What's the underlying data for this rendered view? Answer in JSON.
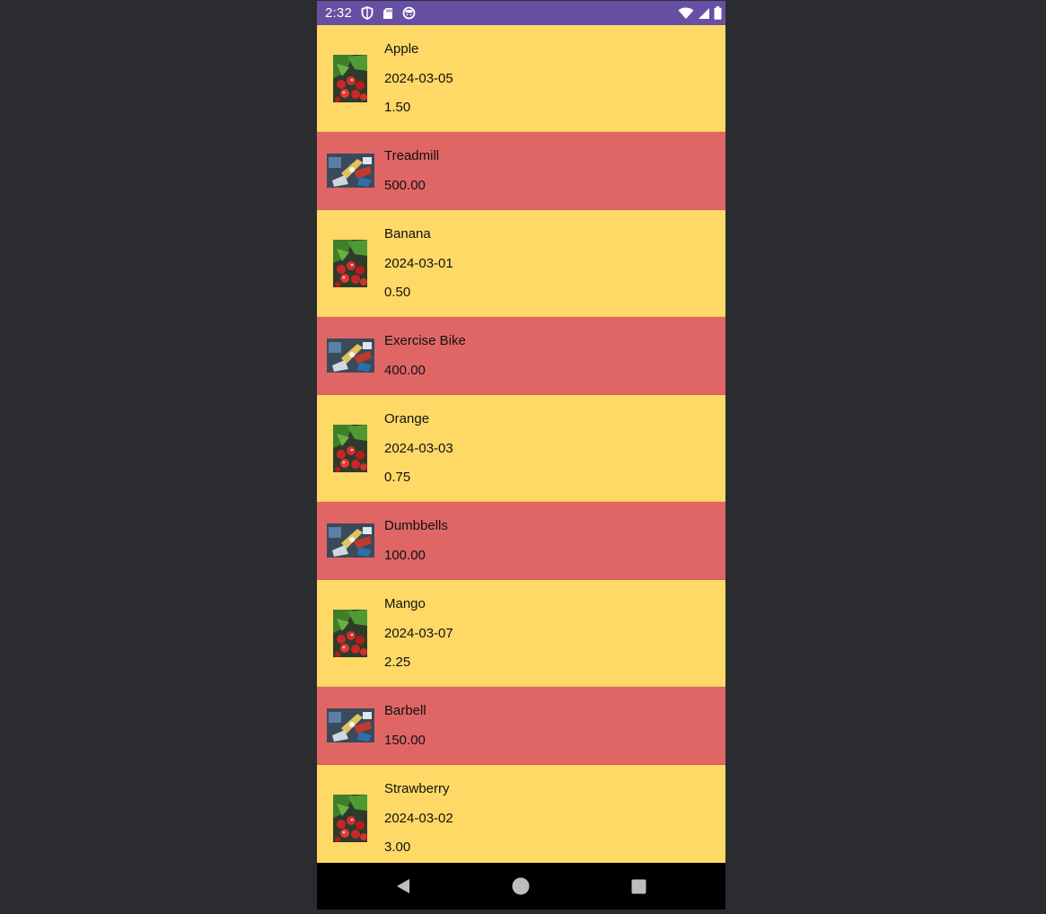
{
  "status_bar": {
    "time": "2:32",
    "left_icons": [
      "shield-icon",
      "sd-card-icon",
      "notification-face-icon"
    ],
    "right_icons": [
      "wifi-icon",
      "signal-icon",
      "battery-icon"
    ],
    "color": "#6750a4"
  },
  "colors": {
    "fruit_row": "#ffd966",
    "equipment_row": "#e06666",
    "background": "#2b2c30"
  },
  "items": [
    {
      "kind": "fruit",
      "name": "Apple",
      "date": "2024-03-05",
      "price": "1.50",
      "image": "fruit-thumbnail"
    },
    {
      "kind": "equip",
      "name": "Treadmill",
      "price": "500.00",
      "image": "equipment-thumbnail"
    },
    {
      "kind": "fruit",
      "name": "Banana",
      "date": "2024-03-01",
      "price": "0.50",
      "image": "fruit-thumbnail"
    },
    {
      "kind": "equip",
      "name": "Exercise Bike",
      "price": "400.00",
      "image": "equipment-thumbnail"
    },
    {
      "kind": "fruit",
      "name": "Orange",
      "date": "2024-03-03",
      "price": "0.75",
      "image": "fruit-thumbnail"
    },
    {
      "kind": "equip",
      "name": "Dumbbells",
      "price": "100.00",
      "image": "equipment-thumbnail"
    },
    {
      "kind": "fruit",
      "name": "Mango",
      "date": "2024-03-07",
      "price": "2.25",
      "image": "fruit-thumbnail"
    },
    {
      "kind": "equip",
      "name": "Barbell",
      "price": "150.00",
      "image": "equipment-thumbnail"
    },
    {
      "kind": "fruit",
      "name": "Strawberry",
      "date": "2024-03-02",
      "price": "3.00",
      "image": "fruit-thumbnail"
    }
  ],
  "nav_bar": {
    "buttons": [
      "back-icon",
      "home-icon",
      "recents-icon"
    ]
  }
}
